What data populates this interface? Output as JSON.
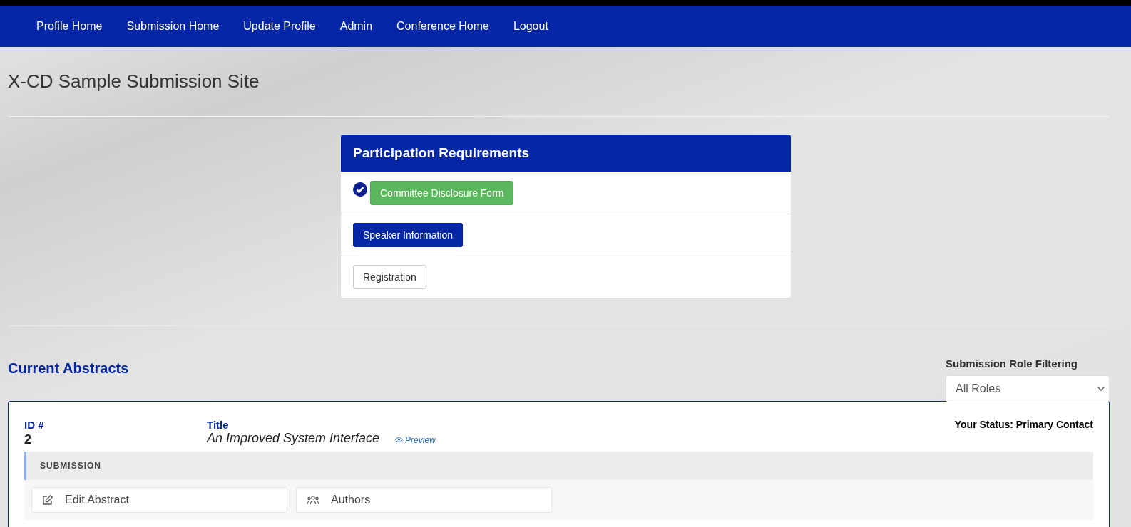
{
  "nav": {
    "items": [
      {
        "label": "Profile Home"
      },
      {
        "label": "Submission Home"
      },
      {
        "label": "Update Profile"
      },
      {
        "label": "Admin"
      },
      {
        "label": "Conference Home"
      },
      {
        "label": "Logout"
      }
    ]
  },
  "site_title": "X-CD Sample Submission Site",
  "requirements": {
    "title": "Participation Requirements",
    "items": [
      {
        "label": "Committee Disclosure Form",
        "kind": "success",
        "completed": true
      },
      {
        "label": "Speaker Information",
        "kind": "primary",
        "completed": false
      },
      {
        "label": "Registration",
        "kind": "default",
        "completed": false
      }
    ]
  },
  "abstracts": {
    "heading": "Current Abstracts",
    "filter": {
      "label": "Submission Role Filtering",
      "value": "All Roles"
    },
    "items": [
      {
        "id_label": "ID #",
        "id": "2",
        "title_label": "Title",
        "title": "An Improved System Interface",
        "preview": "Preview",
        "status": "Your Status: Primary Contact",
        "section": "SUBMISSION",
        "actions": [
          {
            "label": "Edit Abstract",
            "kind": "edit"
          },
          {
            "label": "Authors",
            "kind": "authors"
          }
        ]
      }
    ]
  }
}
